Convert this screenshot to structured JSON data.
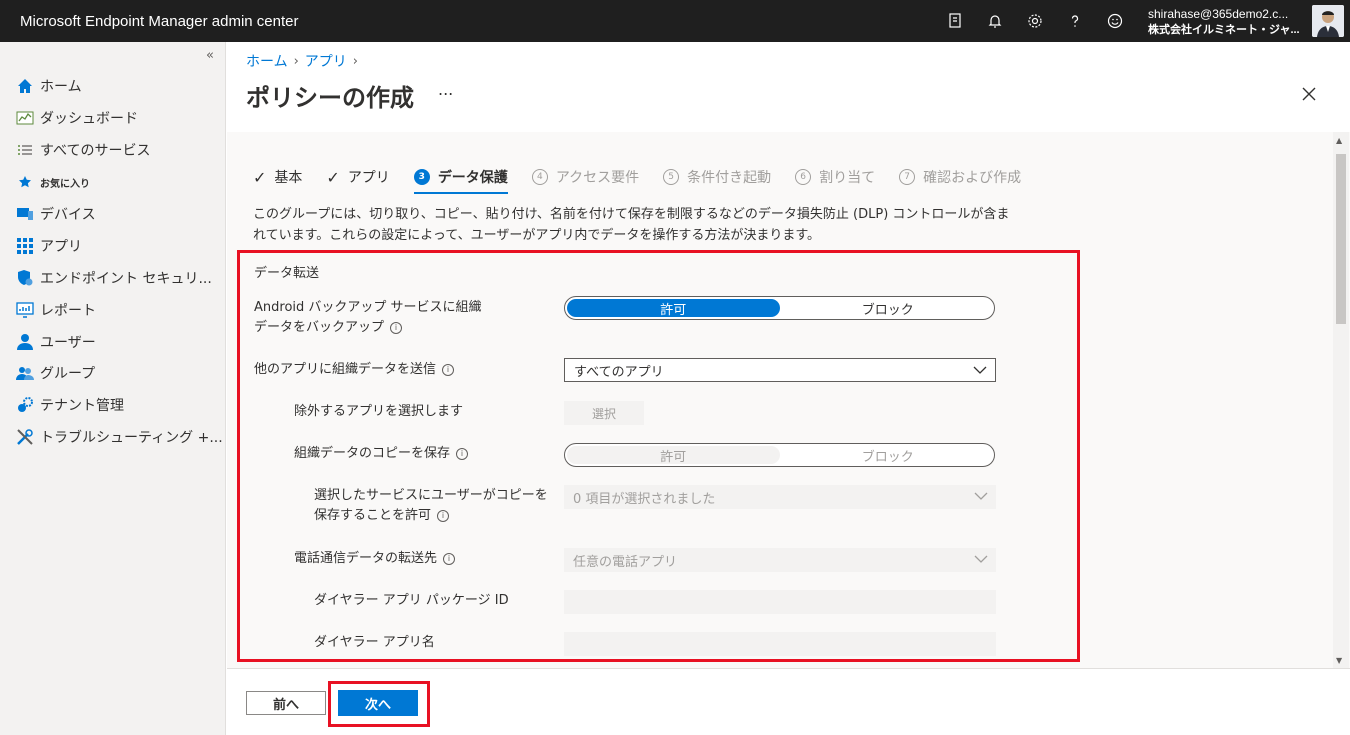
{
  "header": {
    "app_title": "Microsoft Endpoint Manager admin center",
    "account_email": "shirahase@365demo2.c...",
    "account_tenant": "株式会社イルミネート・ジャ..."
  },
  "sidebar": {
    "items": [
      {
        "label": "ホーム",
        "icon": "home-icon"
      },
      {
        "label": "ダッシュボード",
        "icon": "dashboard-icon"
      },
      {
        "label": "すべてのサービス",
        "icon": "list-icon"
      },
      {
        "label": "お気に入り",
        "icon": "star-icon"
      },
      {
        "label": "デバイス",
        "icon": "device-icon"
      },
      {
        "label": "アプリ",
        "icon": "apps-icon"
      },
      {
        "label": "エンドポイント セキュリ...",
        "icon": "shield-icon"
      },
      {
        "label": "レポート",
        "icon": "report-icon"
      },
      {
        "label": "ユーザー",
        "icon": "user-icon"
      },
      {
        "label": "グループ",
        "icon": "group-icon"
      },
      {
        "label": "テナント管理",
        "icon": "tenant-icon"
      },
      {
        "label": "トラブルシューティング +...",
        "icon": "wrench-icon"
      }
    ]
  },
  "breadcrumb": {
    "home": "ホーム",
    "apps": "アプリ"
  },
  "page": {
    "title": "ポリシーの作成",
    "more": "..."
  },
  "steps": [
    {
      "num": "",
      "label": "基本",
      "state": "done"
    },
    {
      "num": "",
      "label": "アプリ",
      "state": "done"
    },
    {
      "num": "3",
      "label": "データ保護",
      "state": "current"
    },
    {
      "num": "4",
      "label": "アクセス要件",
      "state": "pending"
    },
    {
      "num": "5",
      "label": "条件付き起動",
      "state": "pending"
    },
    {
      "num": "6",
      "label": "割り当て",
      "state": "pending"
    },
    {
      "num": "7",
      "label": "確認および作成",
      "state": "pending"
    }
  ],
  "description": "このグループには、切り取り、コピー、貼り付け、名前を付けて保存を制限するなどのデータ損失防止 (DLP) コントロールが含まれています。これらの設定によって、ユーザーがアプリ内でデータを操作する方法が決まります。",
  "form": {
    "section_title": "データ転送",
    "backup_label_1": "Android バックアップ サービスに組織",
    "backup_label_2": "データをバックアップ",
    "allow": "許可",
    "block": "ブロック",
    "send_label": "他のアプリに組織データを送信",
    "send_value": "すべてのアプリ",
    "exclude_label": "除外するアプリを選択します",
    "select_button": "選択",
    "save_copy_label": "組織データのコピーを保存",
    "allow_services_label_1": "選択したサービスにユーザーがコピーを",
    "allow_services_label_2": "保存することを許可",
    "allow_services_value": "0 項目が選択されました",
    "phone_label": "電話通信データの転送先",
    "phone_value": "任意の電話アプリ",
    "dialer_id_label": "ダイヤラー アプリ パッケージ ID",
    "dialer_name_label": "ダイヤラー アプリ名"
  },
  "footer": {
    "prev": "前へ",
    "next": "次へ"
  },
  "colors": {
    "accent": "#0078d4",
    "highlight": "#e81123",
    "topbar": "#1f1f1f"
  }
}
